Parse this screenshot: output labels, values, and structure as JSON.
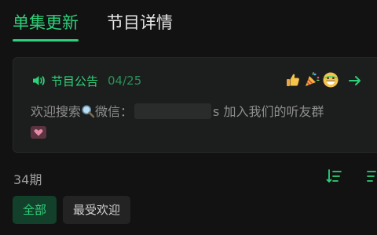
{
  "tabs": [
    {
      "label": "单集更新",
      "active": true
    },
    {
      "label": "节目详情",
      "active": false
    }
  ],
  "notice": {
    "title": "节目公告",
    "date": "04/25",
    "body_before_icon": "欢迎搜索",
    "body_after_icon": "微信：",
    "body_after_blur": "s 加入我们的听友群"
  },
  "episodes": {
    "count": "34期"
  },
  "filters": [
    {
      "label": "全部",
      "active": true
    },
    {
      "label": "最受欢迎",
      "active": false
    }
  ],
  "colors": {
    "accent": "#2fd07a",
    "background": "#121212",
    "card": "#1c1e1d",
    "muted_text": "#8e8e8e"
  },
  "icons": [
    "speaker-icon",
    "thumbs-up-icon",
    "party-popper-icon",
    "grinning-face-icon",
    "arrow-right-icon",
    "magnifier-icon",
    "heart-icon",
    "sort-order-icon",
    "sort-alt-icon"
  ]
}
